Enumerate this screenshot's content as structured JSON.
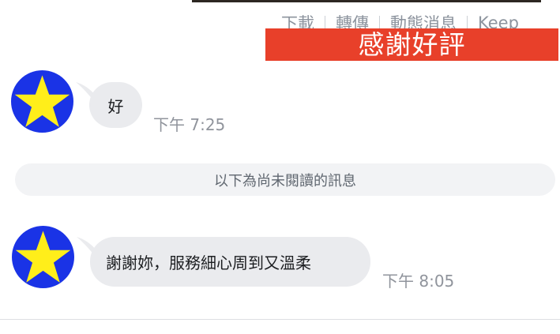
{
  "header": {
    "actions": [
      "下載",
      "轉傳",
      "動態消息",
      "Keep"
    ]
  },
  "banner": {
    "text": "感謝好評",
    "color": "#e8402a"
  },
  "messages": [
    {
      "text": "好",
      "time": "下午 7:25",
      "avatar_icon": "star-icon"
    },
    {
      "text": "謝謝妳，服務細心周到又溫柔",
      "time": "下午 8:05",
      "avatar_icon": "star-icon"
    }
  ],
  "unread_divider": {
    "label": "以下為尚未閱讀的訊息"
  },
  "colors": {
    "avatar_bg": "#1a33e6",
    "star": "#ffee1a",
    "bubble": "#eaebee"
  }
}
